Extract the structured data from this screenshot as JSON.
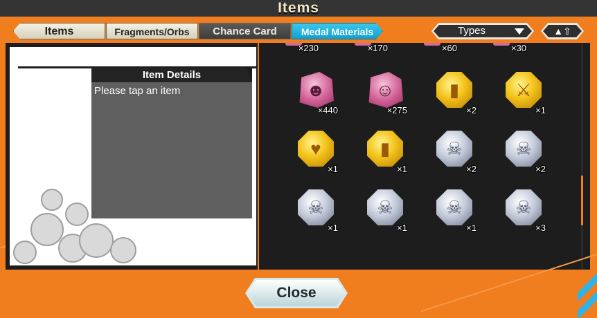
{
  "window": {
    "title": "Items"
  },
  "tabs": [
    {
      "label": "Items"
    },
    {
      "label": "Fragments/Orbs"
    },
    {
      "label": "Chance Card"
    },
    {
      "label": "Medal Materials",
      "active": true
    }
  ],
  "sort": {
    "selected": "Types",
    "dropdown_icon": "triangle-down-icon",
    "order_icon": "up-down-arrows-icon"
  },
  "details": {
    "header": "Item Details",
    "text": "Please tap an item"
  },
  "items_partial_row": [
    {
      "qty": "×230"
    },
    {
      "qty": "×170"
    },
    {
      "qty": "×60"
    },
    {
      "qty": "×30"
    }
  ],
  "items": [
    {
      "kind": "character",
      "icon": "character-portrait-icon",
      "qty": "×440"
    },
    {
      "kind": "character",
      "icon": "character-portrait-icon",
      "qty": "×275"
    },
    {
      "kind": "gold-medal",
      "icon": "armor-medal-icon",
      "qty": "×2"
    },
    {
      "kind": "gold-medal",
      "icon": "sword-medal-icon",
      "qty": "×1"
    },
    {
      "kind": "gold-medal",
      "icon": "heart-medal-icon",
      "qty": "×1"
    },
    {
      "kind": "gold-medal",
      "icon": "armor-medal-icon",
      "qty": "×1"
    },
    {
      "kind": "silver-medal",
      "icon": "skull-medal-icon",
      "qty": "×2"
    },
    {
      "kind": "silver-medal",
      "icon": "skull-medal-icon",
      "qty": "×2"
    },
    {
      "kind": "silver-medal",
      "icon": "skull-medal-icon",
      "qty": "×1"
    },
    {
      "kind": "silver-medal",
      "icon": "skull-medal-icon",
      "qty": "×1"
    },
    {
      "kind": "silver-medal",
      "icon": "skull-medal-icon",
      "qty": "×1"
    },
    {
      "kind": "silver-medal",
      "icon": "skull-medal-icon",
      "qty": "×3"
    }
  ],
  "footer": {
    "close_label": "Close"
  },
  "colors": {
    "accent": "#f07d1e",
    "active_tab": "#1fb0dd",
    "panel": "#1d1d1d"
  }
}
